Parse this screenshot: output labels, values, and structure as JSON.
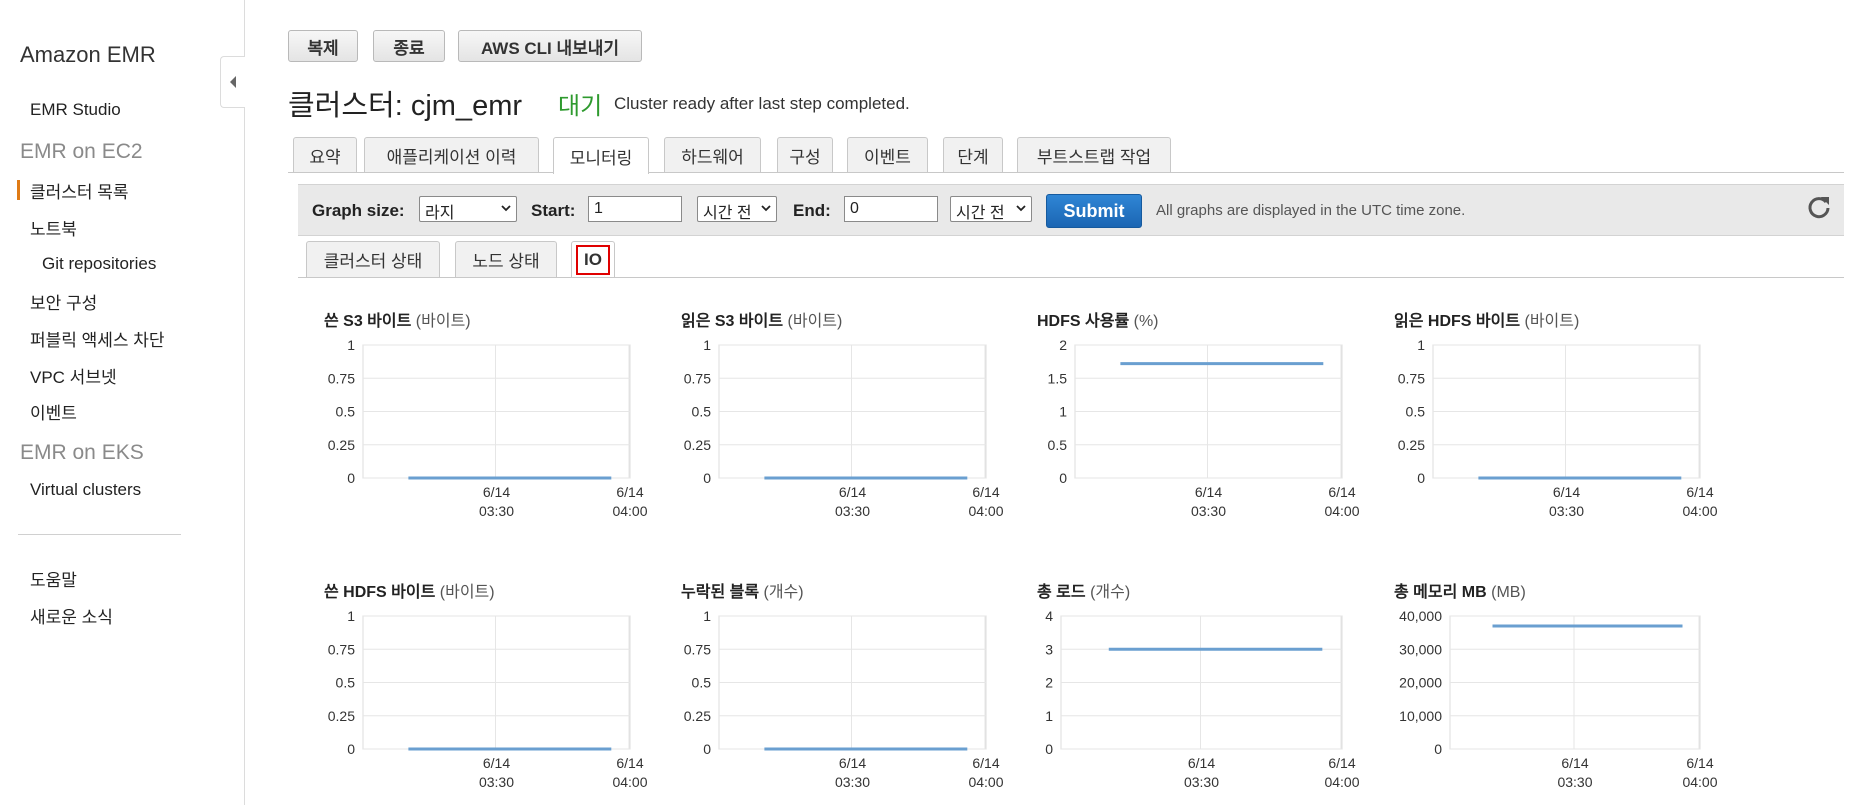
{
  "sidebar": {
    "brand": "Amazon EMR",
    "studio": "EMR Studio",
    "ec2_group": "EMR on EC2",
    "clusters": "클러스터 목록",
    "notebooks": "노트북",
    "git": "Git repositories",
    "security": "보안 구성",
    "public_access": "퍼블릭 액세스 차단",
    "vpc": "VPC 서브넷",
    "events": "이벤트",
    "eks_group": "EMR on EKS",
    "virtual": "Virtual clusters",
    "help": "도움말",
    "whats_new": "새로운 소식"
  },
  "toolbar": {
    "clone": "복제",
    "terminate": "종료",
    "export": "AWS CLI 내보내기"
  },
  "cluster": {
    "title": "클러스터: cjm_emr",
    "status": "대기",
    "status_message": "Cluster ready after last step completed."
  },
  "tabs": [
    "요약",
    "애플리케이션 이력",
    "모니터링",
    "하드웨어",
    "구성",
    "이벤트",
    "단계",
    "부트스트랩 작업"
  ],
  "filters": {
    "graph_size_label": "Graph size:",
    "graph_size_value": "라지",
    "start_label": "Start:",
    "start_value": "1",
    "start_unit": "시간 전",
    "end_label": "End:",
    "end_value": "0",
    "end_unit": "시간 전",
    "submit": "Submit",
    "timezone_note": "All graphs are displayed in the UTC time zone."
  },
  "subtabs": [
    "클러스터 상태",
    "노드 상태",
    "IO"
  ],
  "colors": {
    "line": "#6a9fd0",
    "status_green": "#2e9a2e",
    "active_marker": "#e07b16",
    "highlight": "#e00000",
    "submit_blue": "#1b66b3"
  },
  "icons": {
    "collapse": "chevron-left-icon",
    "refresh": "refresh-icon",
    "dropdown": "chevron-down-icon"
  },
  "chart_data": [
    {
      "type": "line",
      "title": "쓴 S3 바이트",
      "unit": "(바이트)",
      "yticks": [
        "1",
        "0.75",
        "0.5",
        "0.25",
        "0"
      ],
      "ylim": [
        0,
        1
      ],
      "x": [
        "6/14 03:30",
        "6/14 04:00"
      ],
      "series": [
        {
          "values": [
            0,
            0
          ]
        }
      ]
    },
    {
      "type": "line",
      "title": "읽은 S3 바이트",
      "unit": "(바이트)",
      "yticks": [
        "1",
        "0.75",
        "0.5",
        "0.25",
        "0"
      ],
      "ylim": [
        0,
        1
      ],
      "x": [
        "6/14 03:30",
        "6/14 04:00"
      ],
      "series": [
        {
          "values": [
            0,
            0
          ]
        }
      ]
    },
    {
      "type": "line",
      "title": "HDFS 사용률",
      "unit": "(%)",
      "yticks": [
        "2",
        "1.5",
        "1",
        "0.5",
        "0"
      ],
      "ylim": [
        0,
        2
      ],
      "x": [
        "6/14 03:30",
        "6/14 04:00"
      ],
      "series": [
        {
          "values": [
            1.72,
            1.72
          ]
        }
      ]
    },
    {
      "type": "line",
      "title": "읽은 HDFS 바이트",
      "unit": "(바이트)",
      "yticks": [
        "1",
        "0.75",
        "0.5",
        "0.25",
        "0"
      ],
      "ylim": [
        0,
        1
      ],
      "x": [
        "6/14 03:30",
        "6/14 04:00"
      ],
      "series": [
        {
          "values": [
            0,
            0
          ]
        }
      ]
    },
    {
      "type": "line",
      "title": "쓴 HDFS 바이트",
      "unit": "(바이트)",
      "yticks": [
        "1",
        "0.75",
        "0.5",
        "0.25",
        "0"
      ],
      "ylim": [
        0,
        1
      ],
      "x": [
        "6/14 03:30",
        "6/14 04:00"
      ],
      "series": [
        {
          "values": [
            0,
            0
          ]
        }
      ]
    },
    {
      "type": "line",
      "title": "누락된 블록",
      "unit": "(개수)",
      "yticks": [
        "1",
        "0.75",
        "0.5",
        "0.25",
        "0"
      ],
      "ylim": [
        0,
        1
      ],
      "x": [
        "6/14 03:30",
        "6/14 04:00"
      ],
      "series": [
        {
          "values": [
            0,
            0
          ]
        }
      ]
    },
    {
      "type": "line",
      "title": "총 로드",
      "unit": "(개수)",
      "yticks": [
        "4",
        "3",
        "2",
        "1",
        "0"
      ],
      "ylim": [
        0,
        4
      ],
      "x": [
        "6/14 03:30",
        "6/14 04:00"
      ],
      "series": [
        {
          "values": [
            3,
            3
          ]
        }
      ]
    },
    {
      "type": "line",
      "title": "총 메모리 MB",
      "unit": "(MB)",
      "yticks": [
        "40,000",
        "30,000",
        "20,000",
        "10,000",
        "0"
      ],
      "ylim": [
        0,
        40000
      ],
      "x": [
        "6/14 03:30",
        "6/14 04:00"
      ],
      "series": [
        {
          "values": [
            37000,
            37000
          ]
        }
      ]
    }
  ]
}
